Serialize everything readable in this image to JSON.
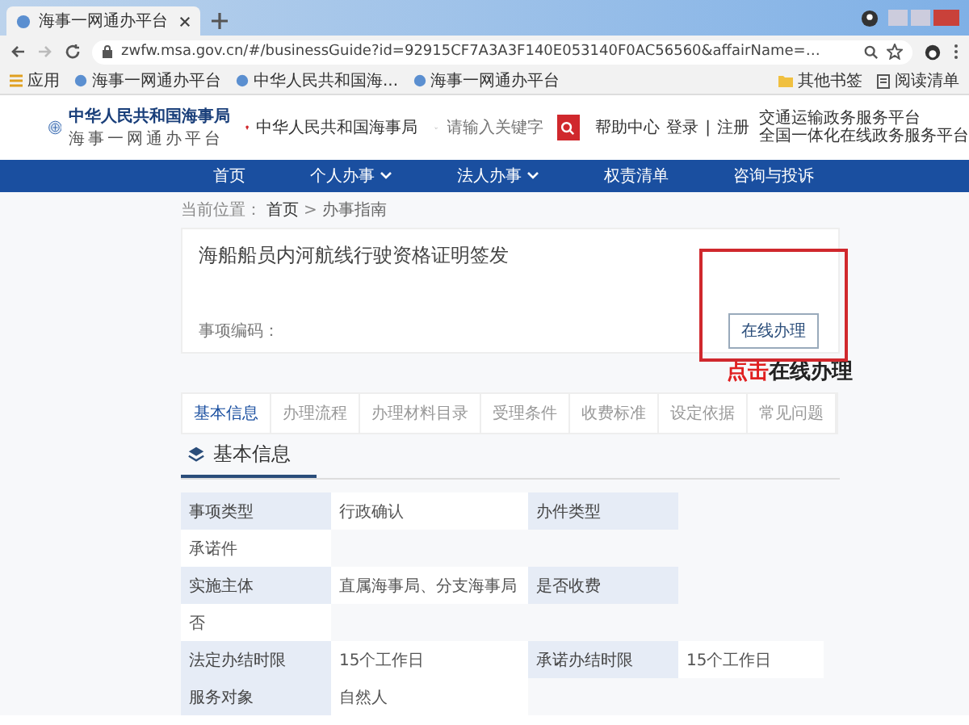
{
  "browser": {
    "tab_title": "海事一网通办平台",
    "url": "zwfw.msa.gov.cn/#/businessGuide?id=92915CF7A3A3F140E053140F0AC56560&affairName=…",
    "bookmarks": [
      {
        "label": "应用",
        "kind": "apps"
      },
      {
        "label": "海事一网通办平台",
        "kind": "site"
      },
      {
        "label": "中华人民共和国海...",
        "kind": "site"
      },
      {
        "label": "海事一网通办平台",
        "kind": "site"
      }
    ],
    "bookmarks_right": [
      {
        "label": "其他书签",
        "kind": "folder"
      },
      {
        "label": "阅读清单",
        "kind": "list"
      }
    ]
  },
  "header": {
    "org_name": "中华人民共和国海事局",
    "platform_name": "海事一网通办平台",
    "location": "中华人民共和国海事局",
    "search": {
      "placeholder": "请输入关键字"
    },
    "help": "帮助中心",
    "login": "登录",
    "separator": "|",
    "register": "注册",
    "portal_links": [
      "交通运输政务服务平台",
      "全国一体化在线政务服务平台"
    ]
  },
  "nav": [
    {
      "label": "首页",
      "dropdown": false
    },
    {
      "label": "个人办事",
      "dropdown": true
    },
    {
      "label": "法人办事",
      "dropdown": true
    },
    {
      "label": "权责清单",
      "dropdown": false
    },
    {
      "label": "咨询与投诉",
      "dropdown": false
    }
  ],
  "breadcrumb": {
    "prefix": "当前位置：",
    "separator": ">",
    "items": [
      "首页",
      "办事指南"
    ]
  },
  "guide": {
    "title": "海船船员内河航线行驶资格证明签发",
    "code_label": "事项编码：",
    "button": "在线办理",
    "callout": {
      "highlight": "点击",
      "text": "在线办理"
    }
  },
  "tabs": [
    {
      "label": "基本信息",
      "selected": true
    },
    {
      "label": "办理流程",
      "selected": false
    },
    {
      "label": "办理材料目录",
      "selected": false
    },
    {
      "label": "受理条件",
      "selected": false
    },
    {
      "label": "收费标准",
      "selected": false
    },
    {
      "label": "设定依据",
      "selected": false
    },
    {
      "label": "常见问题",
      "selected": false
    }
  ],
  "section_title": "基本信息",
  "info_rows": [
    {
      "cells": [
        {
          "kind": "label",
          "text": "事项类型"
        },
        {
          "kind": "value",
          "text": "行政确认"
        },
        {
          "kind": "label",
          "text": "办件类型"
        }
      ]
    },
    {
      "cells": [
        {
          "kind": "value",
          "text": "承诺件"
        }
      ]
    },
    {
      "cells": [
        {
          "kind": "label",
          "text": "实施主体"
        },
        {
          "kind": "value",
          "text": "直属海事局、分支海事局"
        },
        {
          "kind": "label",
          "text": "是否收费"
        }
      ]
    },
    {
      "cells": [
        {
          "kind": "value",
          "text": "否"
        }
      ]
    },
    {
      "cells": [
        {
          "kind": "label",
          "text": "法定办结时限"
        },
        {
          "kind": "value",
          "text": "15个工作日"
        },
        {
          "kind": "label",
          "text": "承诺办结时限"
        },
        {
          "kind": "value",
          "text": "15个工作日"
        }
      ]
    },
    {
      "cells": [
        {
          "kind": "label",
          "text": "服务对象"
        },
        {
          "kind": "value",
          "text": "自然人"
        }
      ]
    }
  ]
}
